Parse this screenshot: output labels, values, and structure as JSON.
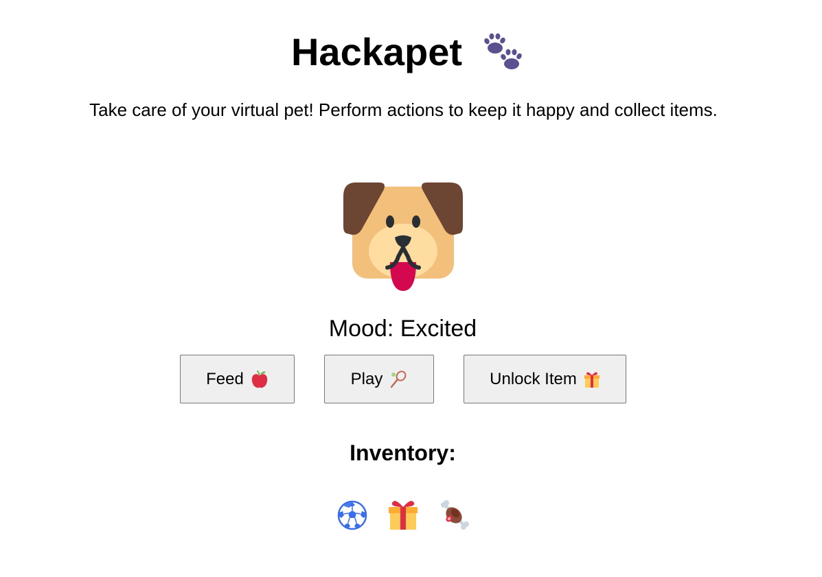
{
  "header": {
    "title": "Hackapet",
    "title_icon": "paw-prints-icon",
    "subtitle": "Take care of your virtual pet! Perform actions to keep it happy and collect items."
  },
  "pet": {
    "icon": "dog-face-icon",
    "mood_label": "Mood: Excited"
  },
  "actions": {
    "feed": {
      "label": "Feed",
      "icon": "apple-icon"
    },
    "play": {
      "label": "Play",
      "icon": "tennis-racket-icon"
    },
    "unlock": {
      "label": "Unlock Item",
      "icon": "gift-icon"
    }
  },
  "inventory": {
    "heading": "Inventory:",
    "items": [
      {
        "icon": "soccer-ball-icon"
      },
      {
        "icon": "gift-icon"
      },
      {
        "icon": "meat-on-bone-icon"
      }
    ]
  },
  "colors": {
    "button_bg": "#efefef",
    "button_border": "#767676",
    "paw": "#5c5190",
    "dog_face": "#f3c07b",
    "dog_ears": "#6d4533",
    "tongue": "#d4084e"
  }
}
